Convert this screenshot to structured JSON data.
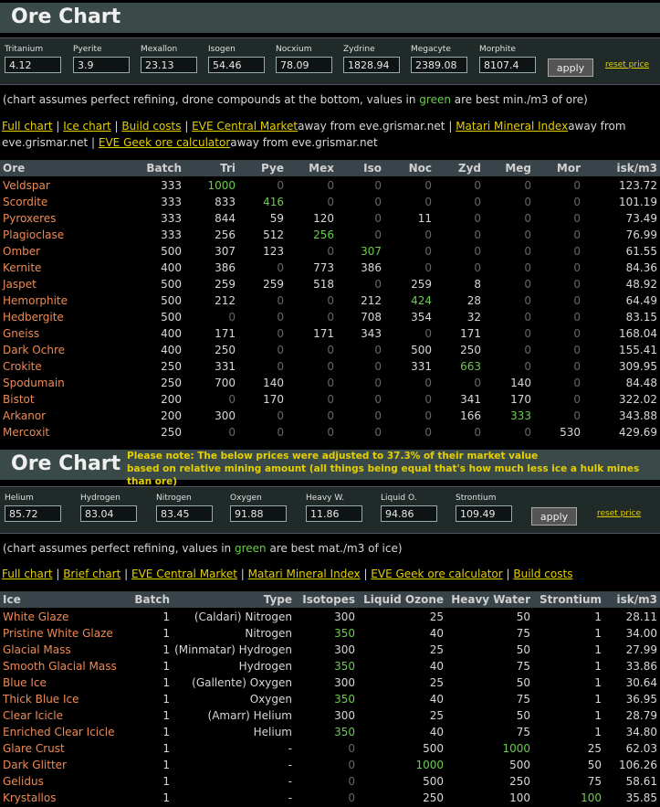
{
  "ore": {
    "title": "Ore Chart",
    "prices": [
      {
        "label": "Tritanium",
        "value": "4.12"
      },
      {
        "label": "Pyerite",
        "value": "3.9"
      },
      {
        "label": "Mexallon",
        "value": "23.13"
      },
      {
        "label": "Isogen",
        "value": "54.46"
      },
      {
        "label": "Nocxium",
        "value": "78.09"
      },
      {
        "label": "Zydrine",
        "value": "1828.94"
      },
      {
        "label": "Megacyte",
        "value": "2389.08"
      },
      {
        "label": "Morphite",
        "value": "8107.4"
      }
    ],
    "apply": "apply",
    "reset": "reset price",
    "note_pre": "(chart assumes perfect refining, drone compounds at the bottom, values in ",
    "note_green": "green",
    "note_post": " are best min./m3 of ore)",
    "links_line1": [
      {
        "t": "Full chart",
        "link": true
      },
      {
        "t": " | "
      },
      {
        "t": "Ice chart",
        "link": true
      },
      {
        "t": " | "
      },
      {
        "t": "Build costs",
        "link": true
      },
      {
        "t": " | "
      },
      {
        "t": "EVE Central Market",
        "link": true
      },
      {
        "t": "away from eve.grismar.net | "
      },
      {
        "t": "Matari Mineral Index",
        "link": true
      },
      {
        "t": "away from"
      }
    ],
    "links_line2": [
      {
        "t": "eve.grismar.net | "
      },
      {
        "t": "EVE Geek ore calculator",
        "link": true
      },
      {
        "t": "away from eve.grismar.net"
      }
    ],
    "headers": [
      "Ore",
      "Batch",
      "Tri",
      "Pye",
      "Mex",
      "Iso",
      "Noc",
      "Zyd",
      "Meg",
      "Mor",
      "isk/m3"
    ],
    "rows": [
      [
        "Veldspar",
        "333",
        "1000",
        "0",
        "0",
        "0",
        "0",
        "0",
        "0",
        "0",
        "123.72"
      ],
      [
        "Scordite",
        "333",
        "833",
        "416",
        "0",
        "0",
        "0",
        "0",
        "0",
        "0",
        "101.19"
      ],
      [
        "Pyroxeres",
        "333",
        "844",
        "59",
        "120",
        "0",
        "11",
        "0",
        "0",
        "0",
        "73.49"
      ],
      [
        "Plagioclase",
        "333",
        "256",
        "512",
        "256",
        "0",
        "0",
        "0",
        "0",
        "0",
        "76.99"
      ],
      [
        "Omber",
        "500",
        "307",
        "123",
        "0",
        "307",
        "0",
        "0",
        "0",
        "0",
        "61.55"
      ],
      [
        "Kernite",
        "400",
        "386",
        "0",
        "773",
        "386",
        "0",
        "0",
        "0",
        "0",
        "84.36"
      ],
      [
        "Jaspet",
        "500",
        "259",
        "259",
        "518",
        "0",
        "259",
        "8",
        "0",
        "0",
        "48.92"
      ],
      [
        "Hemorphite",
        "500",
        "212",
        "0",
        "0",
        "212",
        "424",
        "28",
        "0",
        "0",
        "64.49"
      ],
      [
        "Hedbergite",
        "500",
        "0",
        "0",
        "0",
        "708",
        "354",
        "32",
        "0",
        "0",
        "83.15"
      ],
      [
        "Gneiss",
        "400",
        "171",
        "0",
        "171",
        "343",
        "0",
        "171",
        "0",
        "0",
        "168.04"
      ],
      [
        "Dark Ochre",
        "400",
        "250",
        "0",
        "0",
        "0",
        "500",
        "250",
        "0",
        "0",
        "155.41"
      ],
      [
        "Crokite",
        "250",
        "331",
        "0",
        "0",
        "0",
        "331",
        "663",
        "0",
        "0",
        "309.95"
      ],
      [
        "Spodumain",
        "250",
        "700",
        "140",
        "0",
        "0",
        "0",
        "0",
        "140",
        "0",
        "84.48"
      ],
      [
        "Bistot",
        "200",
        "0",
        "170",
        "0",
        "0",
        "0",
        "341",
        "170",
        "0",
        "322.02"
      ],
      [
        "Arkanor",
        "200",
        "300",
        "0",
        "0",
        "0",
        "0",
        "166",
        "333",
        "0",
        "343.88"
      ],
      [
        "Mercoxit",
        "250",
        "0",
        "0",
        "0",
        "0",
        "0",
        "0",
        "0",
        "530",
        "429.69"
      ]
    ],
    "green": [
      [
        0,
        2
      ],
      [
        1,
        3
      ],
      [
        3,
        4
      ],
      [
        4,
        5
      ],
      [
        7,
        6
      ],
      [
        11,
        7
      ],
      [
        14,
        8
      ]
    ]
  },
  "ice": {
    "title": "Ore Chart",
    "notice_line1": "Please note: The below prices were adjusted to 37.3% of their market value",
    "notice_line2": "based on relative mining amount (all things being equal that's how much less ice a hulk mines than ore)",
    "prices": [
      {
        "label": "Helium",
        "value": "85.72"
      },
      {
        "label": "Hydrogen",
        "value": "83.04"
      },
      {
        "label": "Nitrogen",
        "value": "83.45"
      },
      {
        "label": "Oxygen",
        "value": "91.88"
      },
      {
        "label": "Heavy W.",
        "value": "11.86"
      },
      {
        "label": "Liquid O.",
        "value": "94.86"
      },
      {
        "label": "Strontium",
        "value": "109.49"
      }
    ],
    "apply": "apply",
    "reset": "reset price",
    "note_pre": "(chart assumes perfect refining, values in ",
    "note_green": "green",
    "note_post": " are best mat./m3 of ice)",
    "links_line1": [
      {
        "t": "Full chart",
        "link": true
      },
      {
        "t": " | "
      },
      {
        "t": "Brief chart",
        "link": true
      },
      {
        "t": " | "
      },
      {
        "t": "EVE Central Market",
        "link": true
      },
      {
        "t": " | "
      },
      {
        "t": "Matari Mineral Index",
        "link": true
      },
      {
        "t": " | "
      },
      {
        "t": "EVE Geek ore calculator",
        "link": true
      },
      {
        "t": " | "
      },
      {
        "t": "Build costs",
        "link": true
      }
    ],
    "headers": [
      "Ice",
      "Batch",
      "Type",
      "Isotopes",
      "Liquid Ozone",
      "Heavy Water",
      "Strontium",
      "isk/m3"
    ],
    "rows": [
      [
        "White Glaze",
        "1",
        "(Caldari) Nitrogen",
        "300",
        "25",
        "50",
        "1",
        "28.11"
      ],
      [
        "Pristine White Glaze",
        "1",
        "Nitrogen",
        "350",
        "40",
        "75",
        "1",
        "34.00"
      ],
      [
        "Glacial Mass",
        "1",
        "(Minmatar) Hydrogen",
        "300",
        "25",
        "50",
        "1",
        "27.99"
      ],
      [
        "Smooth Glacial Mass",
        "1",
        "Hydrogen",
        "350",
        "40",
        "75",
        "1",
        "33.86"
      ],
      [
        "Blue Ice",
        "1",
        "(Gallente) Oxygen",
        "300",
        "25",
        "50",
        "1",
        "30.64"
      ],
      [
        "Thick Blue Ice",
        "1",
        "Oxygen",
        "350",
        "40",
        "75",
        "1",
        "36.95"
      ],
      [
        "Clear Icicle",
        "1",
        "(Amarr) Helium",
        "300",
        "25",
        "50",
        "1",
        "28.79"
      ],
      [
        "Enriched Clear Icicle",
        "1",
        "Helium",
        "350",
        "40",
        "75",
        "1",
        "34.80"
      ],
      [
        "Glare Crust",
        "1",
        "-",
        "0",
        "500",
        "1000",
        "25",
        "62.03"
      ],
      [
        "Dark Glitter",
        "1",
        "-",
        "0",
        "1000",
        "500",
        "50",
        "106.26"
      ],
      [
        "Gelidus",
        "1",
        "-",
        "0",
        "500",
        "250",
        "75",
        "58.61"
      ],
      [
        "Krystallos",
        "1",
        "-",
        "0",
        "250",
        "100",
        "100",
        "35.85"
      ]
    ],
    "green": [
      [
        1,
        3
      ],
      [
        3,
        3
      ],
      [
        5,
        3
      ],
      [
        7,
        3
      ],
      [
        8,
        5
      ],
      [
        9,
        4
      ],
      [
        11,
        6
      ]
    ]
  }
}
